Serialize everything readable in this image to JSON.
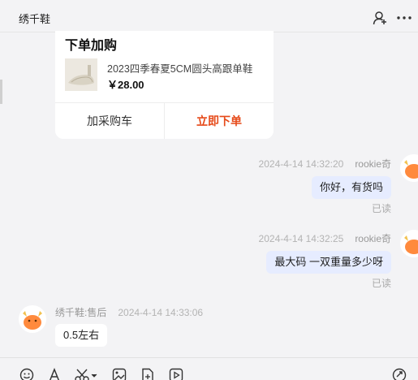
{
  "header": {
    "title": "绣千鞋"
  },
  "product_card": {
    "title": "下单加购",
    "product_name": "2023四季春夏5CM圆头高跟单鞋",
    "price": "￥28.00",
    "add_cart_label": "加采购车",
    "order_label": "立即下单"
  },
  "messages": [
    {
      "direction": "out",
      "timestamp": "2024-4-14 14:32:20",
      "sender": "rookie奇",
      "text": "你好，有货吗",
      "status": "已读"
    },
    {
      "direction": "out",
      "timestamp": "2024-4-14 14:32:25",
      "sender": "rookie奇",
      "text": "最大码 一双重量多少呀",
      "status": "已读"
    },
    {
      "direction": "in",
      "sender": "绣千鞋:售后",
      "timestamp": "2024-4-14 14:33:06",
      "text": "0.5左右"
    }
  ],
  "colors": {
    "accent_order": "#e64a19",
    "bubble_out": "#e6ecff",
    "background": "#f3f3f5"
  },
  "icons": {
    "header": [
      "add-contact-icon",
      "more-icon"
    ],
    "toolbar": [
      "emoji-icon",
      "font-icon",
      "scissors-icon",
      "image-icon",
      "file-icon",
      "video-icon",
      "history-icon"
    ]
  }
}
